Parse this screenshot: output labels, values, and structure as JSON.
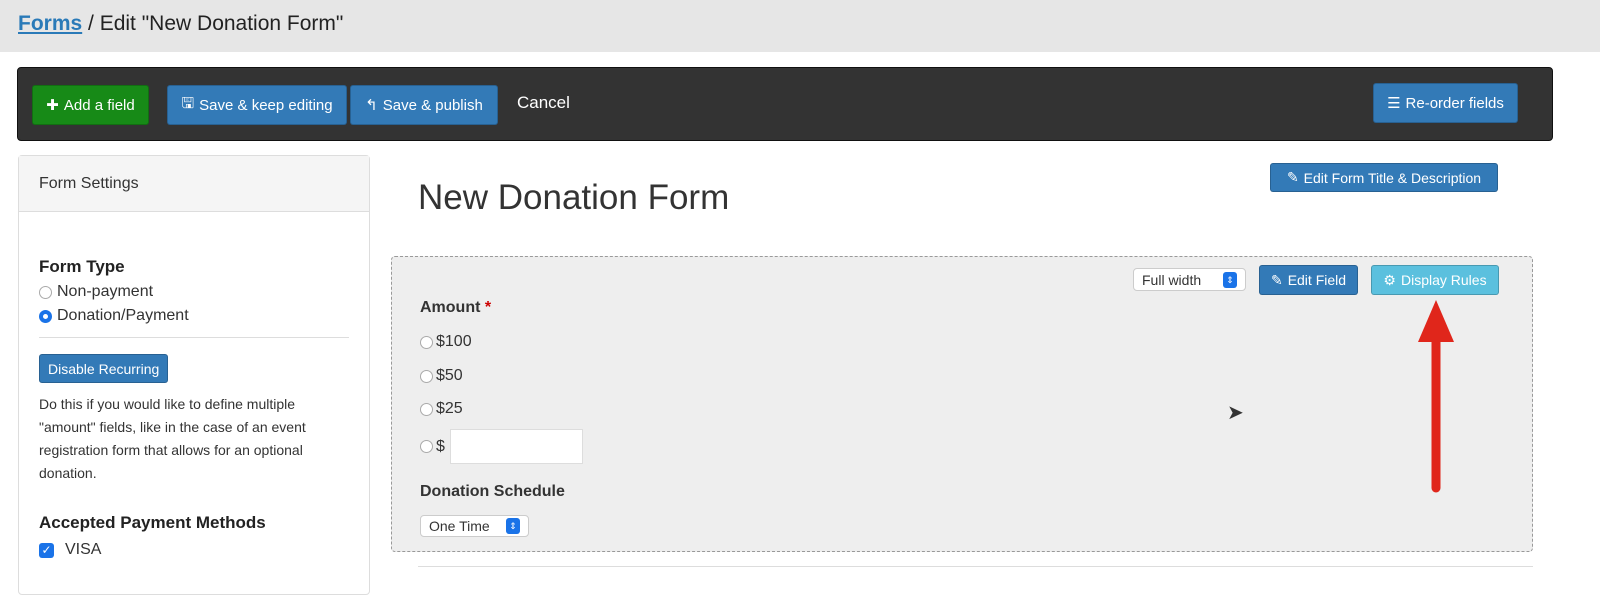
{
  "breadcrumb": {
    "link": "Forms",
    "separator": " / ",
    "current": "Edit \"New Donation Form\""
  },
  "toolbar": {
    "add_field": "Add a field",
    "save_keep": "Save & keep editing",
    "save_publish": "Save & publish",
    "cancel": "Cancel",
    "reorder": "Re-order fields"
  },
  "settings": {
    "header": "Form Settings",
    "form_type_label": "Form Type",
    "form_types": [
      "Non-payment",
      "Donation/Payment"
    ],
    "selected_type": "Donation/Payment",
    "disable_recurring": "Disable Recurring",
    "help": "Do this if you would like to define multiple \"amount\" fields, like in the case of an event registration form that allows for an optional donation.",
    "payment_label": "Accepted Payment Methods",
    "payment_methods": [
      {
        "label": "VISA",
        "checked": true
      }
    ]
  },
  "form": {
    "title": "New Donation Form",
    "edit_title": "Edit Form Title & Description"
  },
  "field": {
    "width_select": "Full width",
    "edit_field": "Edit Field",
    "display_rules": "Display Rules",
    "amount_label": "Amount",
    "required": "*",
    "options": [
      "$100",
      "$50",
      "$25",
      "$"
    ],
    "custom_value": "",
    "schedule_label": "Donation Schedule",
    "schedule_value": "One Time"
  },
  "colors": {
    "green": "#178a17",
    "primary": "#337ab7",
    "info": "#5bc0de",
    "arrow": "#e0261b"
  }
}
